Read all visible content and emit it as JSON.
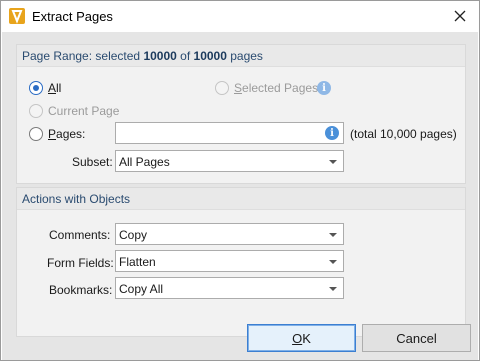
{
  "window": {
    "title": "Extract Pages"
  },
  "colors": {
    "accent": "#2b6cc4",
    "info": "#4a90d9",
    "app_icon": "#e8a41c"
  },
  "page_range": {
    "heading_prefix": "Page Range: selected",
    "selected_count": "10000",
    "heading_mid": "of",
    "total_count": "10000",
    "heading_suffix": "pages",
    "all_label": "All",
    "selected_pages_label": "Selected Pages",
    "current_page_label": "Current Page",
    "pages_label": "Pages:",
    "pages_value": "",
    "total_text": "(total 10,000 pages)",
    "subset_label": "Subset:",
    "subset_value": "All Pages",
    "selected_option": "All"
  },
  "actions": {
    "heading": "Actions with Objects",
    "comments_label": "Comments:",
    "comments_value": "Copy",
    "form_fields_label": "Form Fields:",
    "form_fields_value": "Flatten",
    "bookmarks_label": "Bookmarks:",
    "bookmarks_value": "Copy All"
  },
  "buttons": {
    "ok": "OK",
    "cancel": "Cancel"
  },
  "icons": {
    "app": "pdf-xchange-icon",
    "close": "close-icon",
    "info": "info-icon"
  }
}
